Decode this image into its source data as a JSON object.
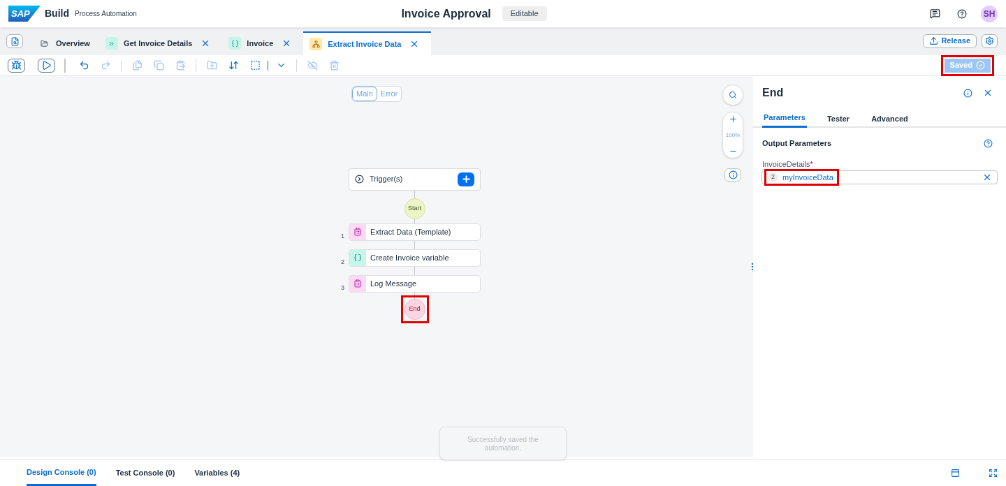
{
  "header": {
    "logo": "SAP",
    "product": "Build",
    "subtitle": "Process Automation",
    "title": "Invoice Approval",
    "badge": "Editable",
    "avatar": "SH"
  },
  "tabs": [
    {
      "label": "Overview",
      "kind": "folder",
      "closable": false,
      "selected": false
    },
    {
      "label": "Get Invoice Details",
      "kind": "action",
      "closable": true,
      "selected": false
    },
    {
      "label": "Invoice",
      "kind": "variable",
      "closable": true,
      "selected": false
    },
    {
      "label": "Extract Invoice Data",
      "kind": "automation",
      "closable": true,
      "selected": true
    }
  ],
  "release_button": "Release",
  "saved_button": {
    "label": "Saved",
    "highlighted": true
  },
  "canvas": {
    "views": [
      {
        "label": "Main",
        "selected": true
      },
      {
        "label": "Error",
        "selected": false
      }
    ],
    "zoom": "100%",
    "trigger": "Trigger(s)",
    "start": "Start",
    "steps": [
      {
        "number": "1",
        "label": "Extract Data (Template)",
        "kind": "activity"
      },
      {
        "number": "2",
        "label": "Create Invoice variable",
        "kind": "variable"
      },
      {
        "number": "3",
        "label": "Log Message",
        "kind": "activity"
      }
    ],
    "end": {
      "label": "End",
      "highlighted": true
    },
    "toast": "Successfully saved the automation."
  },
  "panel": {
    "title": "End",
    "tabs": [
      {
        "label": "Parameters",
        "selected": true
      },
      {
        "label": "Tester",
        "selected": false
      },
      {
        "label": "Advanced",
        "selected": false
      }
    ],
    "section": "Output Parameters",
    "field": {
      "label": "InvoiceDetails",
      "required_mark": "*",
      "token_count": "2",
      "value": "myInvoiceData",
      "highlighted": true
    }
  },
  "console_tabs": [
    {
      "label": "Design Console (0)",
      "selected": true
    },
    {
      "label": "Test Console (0)",
      "selected": false
    },
    {
      "label": "Variables (4)",
      "selected": false
    }
  ]
}
